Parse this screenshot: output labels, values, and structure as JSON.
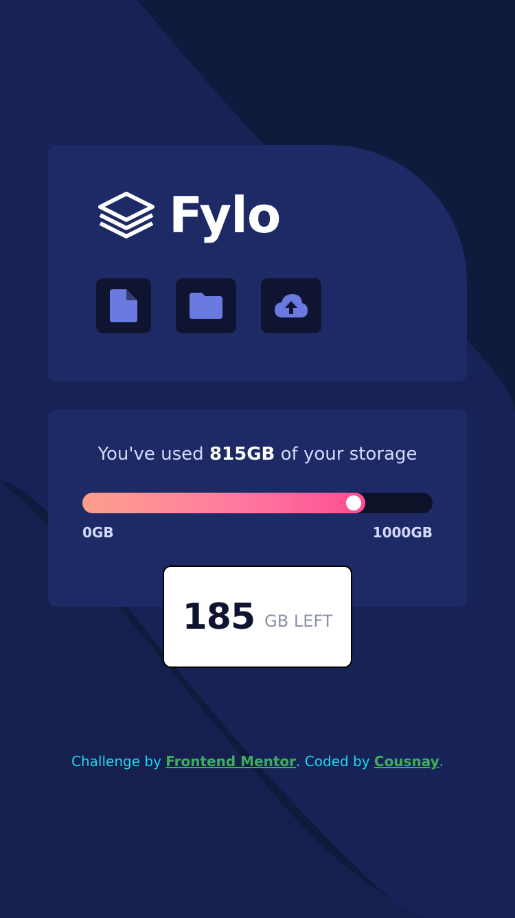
{
  "logo": {
    "wordmark": "Fylo"
  },
  "icons": [
    {
      "name": "document-icon"
    },
    {
      "name": "folder-icon"
    },
    {
      "name": "cloud-upload-icon"
    }
  ],
  "storage": {
    "prefix": "You've used ",
    "used": "815GB",
    "suffix": " of your storage",
    "min_label": "0GB",
    "max_label": "1000GB",
    "used_fraction": 0.815,
    "remaining_amount": "185",
    "remaining_unit": "GB LEFT"
  },
  "attribution": {
    "challenge_prefix": "Challenge by ",
    "challenge_link": "Frontend Mentor",
    "coded_prefix": ". Coded by ",
    "coded_link": "Cousnay",
    "suffix": "."
  },
  "colors": {
    "background": "#0f1b3d",
    "card": "#1d2a66",
    "icon_tile": "#0f1531",
    "icon_fill": "#6a7ae0",
    "gradient_start": "#fda08a",
    "gradient_end": "#fe4d91",
    "attribution_text": "#22d6f0",
    "attribution_link": "#3eae5e"
  }
}
